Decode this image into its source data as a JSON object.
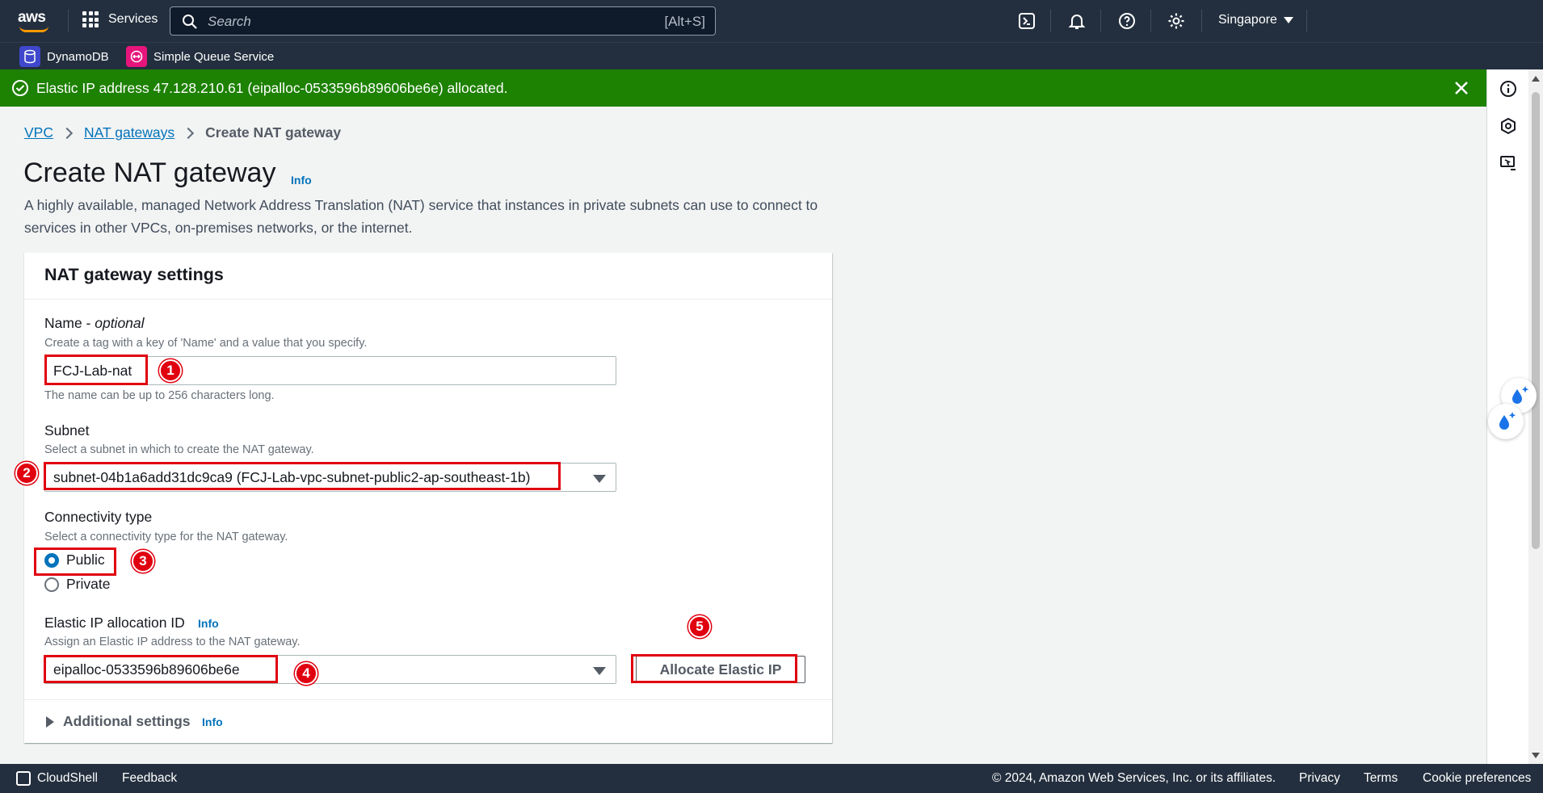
{
  "topnav": {
    "logo_text": "aws",
    "services_label": "Services",
    "search_placeholder": "Search",
    "search_shortcut": "[Alt+S]",
    "region": "Singapore"
  },
  "favorites": [
    {
      "label": "DynamoDB",
      "icon": "dynamodb-icon",
      "color": "#3f48cc"
    },
    {
      "label": "Simple Queue Service",
      "icon": "sqs-icon",
      "color": "#e7157b"
    }
  ],
  "flash": {
    "message": "Elastic IP address 47.128.210.61 (eipalloc-0533596b89606be6e) allocated.",
    "color": "#1d8102"
  },
  "breadcrumb": {
    "items": [
      "VPC",
      "NAT gateways"
    ],
    "current": "Create NAT gateway"
  },
  "page": {
    "title": "Create NAT gateway",
    "info_label": "Info",
    "description": "A highly available, managed Network Address Translation (NAT) service that instances in private subnets can use to connect to services in other VPCs, on-premises networks, or the internet."
  },
  "panel": {
    "title": "NAT gateway settings",
    "name": {
      "label": "Name - ",
      "label_optional": "optional",
      "hint": "Create a tag with a key of 'Name' and a value that you specify.",
      "value": "FCJ-Lab-nat",
      "constraint": "The name can be up to 256 characters long."
    },
    "subnet": {
      "label": "Subnet",
      "hint": "Select a subnet in which to create the NAT gateway.",
      "value": "subnet-04b1a6add31dc9ca9 (FCJ-Lab-vpc-subnet-public2-ap-southeast-1b)"
    },
    "connectivity": {
      "label": "Connectivity type",
      "hint": "Select a connectivity type for the NAT gateway.",
      "options": [
        "Public",
        "Private"
      ],
      "selected": "Public"
    },
    "eip": {
      "label": "Elastic IP allocation ID",
      "info_label": "Info",
      "hint": "Assign an Elastic IP address to the NAT gateway.",
      "value": "eipalloc-0533596b89606be6e",
      "button_label": "Allocate Elastic IP"
    },
    "additional": {
      "label": "Additional settings",
      "info_label": "Info"
    }
  },
  "annotations": [
    "1",
    "2",
    "3",
    "4",
    "5"
  ],
  "footer": {
    "cloudshell": "CloudShell",
    "feedback": "Feedback",
    "copyright": "© 2024, Amazon Web Services, Inc. or its affiliates.",
    "privacy": "Privacy",
    "terms": "Terms",
    "cookies": "Cookie preferences"
  }
}
